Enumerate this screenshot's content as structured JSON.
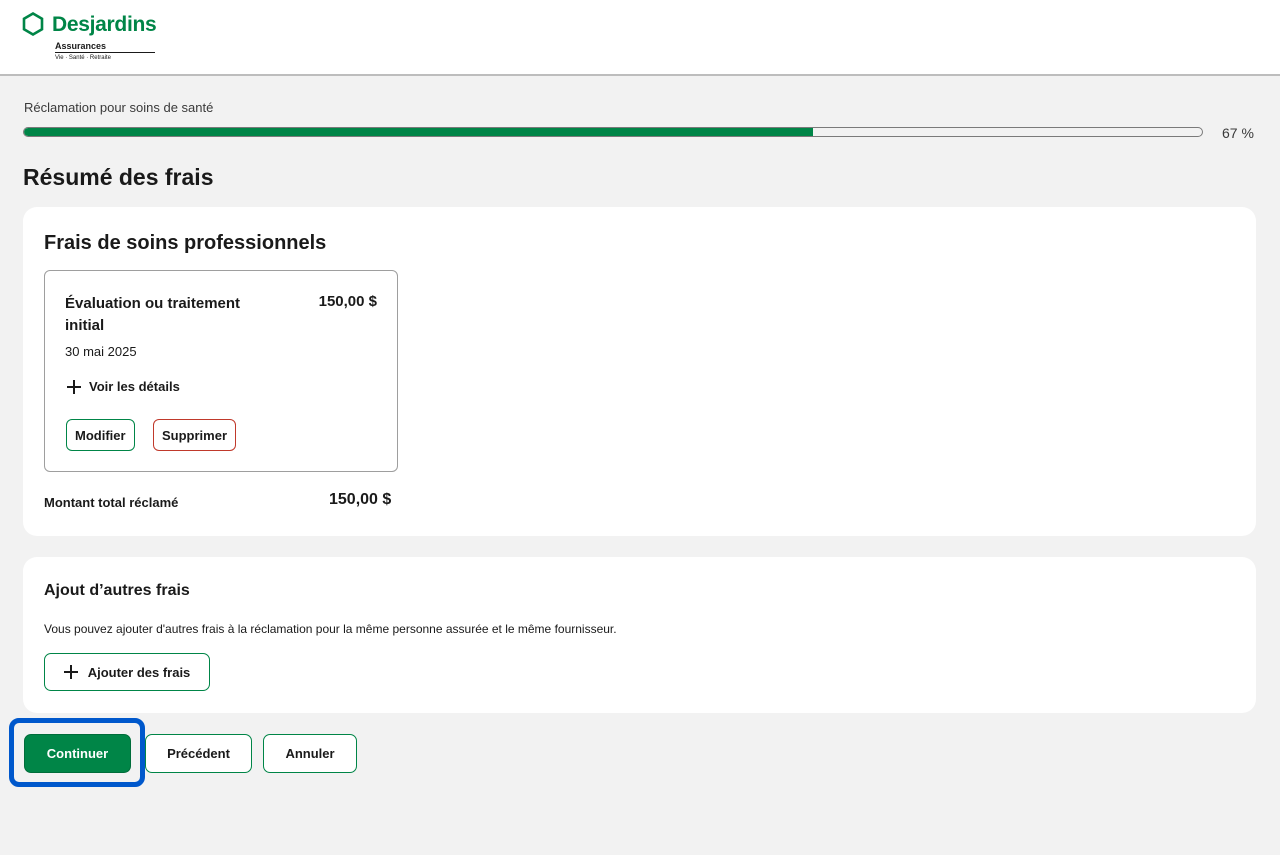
{
  "brand": {
    "name": "Desjardins",
    "subtitle": "Assurances",
    "tagline": "Vie · Santé · Retraite",
    "color": "#008547"
  },
  "progress": {
    "title": "Réclamation pour soins de santé",
    "percent_label": "67 %",
    "value": 0.67
  },
  "page": {
    "title": "Résumé des frais"
  },
  "professional_fees": {
    "title": "Frais de soins professionnels",
    "expense": {
      "name": "Évaluation ou traitement initial",
      "amount": "150,00 $",
      "date": "30 mai 2025",
      "details_label": "Voir les détails",
      "modify_label": "Modifier",
      "delete_label": "Supprimer"
    },
    "total_label": "Montant total réclamé",
    "total_amount": "150,00 $"
  },
  "additional_fees": {
    "title": "Ajout d’autres frais",
    "text": "Vous pouvez ajouter d'autres frais à la réclamation pour la même personne assurée et le même fournisseur.",
    "add_label": "Ajouter des frais"
  },
  "actions": {
    "continue_label": "Continuer",
    "previous_label": "Précédent",
    "cancel_label": "Annuler"
  }
}
